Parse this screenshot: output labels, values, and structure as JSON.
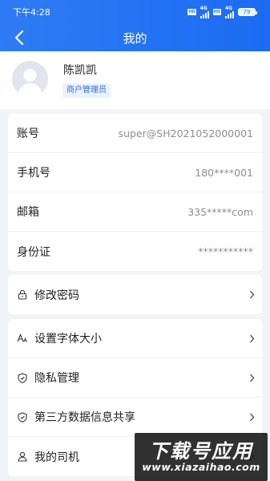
{
  "status_bar": {
    "time": "下午4:28",
    "network_label": "4G",
    "battery": "79"
  },
  "header": {
    "title": "我的"
  },
  "profile": {
    "name": "陈凯凯",
    "role": "商户管理员"
  },
  "account_info": [
    {
      "label": "账号",
      "value": "super@SH2021052000001"
    },
    {
      "label": "手机号",
      "value": "180****001"
    },
    {
      "label": "邮箱",
      "value": "335*****com"
    },
    {
      "label": "身份证",
      "value": "***********"
    }
  ],
  "security_menu": [
    {
      "label": "修改密码",
      "icon": "lock-icon"
    }
  ],
  "settings_menu": [
    {
      "label": "设置字体大小",
      "icon": "font-size-icon"
    },
    {
      "label": "隐私管理",
      "icon": "shield-icon"
    },
    {
      "label": "第三方数据信息共享",
      "icon": "shield-icon"
    },
    {
      "label": "我的司机",
      "icon": "people-icon"
    }
  ],
  "watermark": {
    "title": "下载号应用",
    "url": "www.xiazaihao.com"
  },
  "colors": {
    "primary": "#2f7bf5",
    "badge_bg": "#eaf1fe",
    "badge_text": "#2d6fe0",
    "page_bg": "#f3f4f7"
  }
}
